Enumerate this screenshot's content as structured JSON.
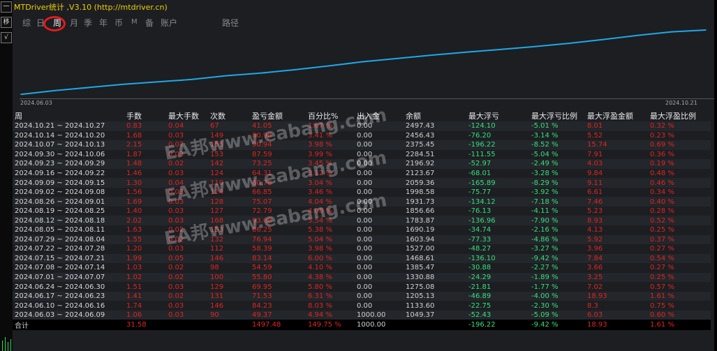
{
  "left_buttons": [
    "一",
    "移",
    "√"
  ],
  "title": "MTDriver统计 ,V3.10 (http://mtdriver.cn)",
  "tabs": [
    "综",
    "日",
    "周",
    "月",
    "季",
    "年",
    "币",
    "M",
    "备",
    "账户",
    "路径"
  ],
  "active_tab": "周",
  "chart_data": {
    "type": "line",
    "x": [
      "2024.06.09",
      "2024.06.16",
      "2024.06.23",
      "2024.06.30",
      "2024.07.07",
      "2024.07.14",
      "2024.07.21",
      "2024.07.28",
      "2024.08.04",
      "2024.08.11",
      "2024.08.18",
      "2024.08.25",
      "2024.09.01",
      "2024.09.08",
      "2024.09.15",
      "2024.09.22",
      "2024.09.29",
      "2024.10.06",
      "2024.10.13",
      "2024.10.20",
      "2024.10.27"
    ],
    "series": [
      {
        "values": [
          1049.37,
          1133.6,
          1205.13,
          1275.08,
          1330.88,
          1385.47,
          1468.61,
          1527.0,
          1603.94,
          1690.19,
          1783.87,
          1856.66,
          1931.73,
          1998.58,
          2059.36,
          2123.67,
          2196.92,
          2284.51,
          2375.45,
          2456.43,
          2497.43
        ]
      }
    ],
    "xlabel_start": "2024.06.03",
    "xlabel_end": "2024.10.21",
    "line_color": "#1fa8e8"
  },
  "table": {
    "headers": [
      "周",
      "手数",
      "最大手数",
      "次数",
      "盈亏金额",
      "百分比%",
      "出入金",
      "余额",
      "最大浮亏",
      "最大浮亏比例",
      "最大浮盈金额",
      "最大浮盈比例"
    ],
    "rows": [
      [
        "2024.10.21 ~ 2024.10.27",
        "0.83",
        "0.04",
        "67",
        "41.05",
        "1.67 %",
        "0.00",
        "2497.43",
        "-124.10",
        "-5.01 %",
        "8.01",
        "0.32 %"
      ],
      [
        "2024.10.14 ~ 2024.10.20",
        "1.68",
        "0.03",
        "149",
        "80.98",
        "3.41 %",
        "0.00",
        "2456.43",
        "-76.20",
        "-3.14 %",
        "5.52",
        "0.23 %"
      ],
      [
        "2024.10.07 ~ 2024.10.13",
        "2.15",
        "0.07",
        "155",
        "90.94",
        "3.98 %",
        "0.00",
        "2375.45",
        "-196.22",
        "-8.52 %",
        "15.74",
        "0.69 %"
      ],
      [
        "2024.09.30 ~ 2024.10.06",
        "1.87",
        "0.03",
        "153",
        "87.59",
        "3.99 %",
        "0.00",
        "2284.51",
        "-111.55",
        "-5.04 %",
        "7.91",
        "0.36 %"
      ],
      [
        "2024.09.23 ~ 2024.09.29",
        "1.48",
        "0.02",
        "142",
        "73.25",
        "3.45 %",
        "0.00",
        "2196.92",
        "-52.97",
        "-2.49 %",
        "4.03",
        "0.19 %"
      ],
      [
        "2024.09.16 ~ 2024.09.22",
        "1.46",
        "0.03",
        "124",
        "64.31",
        "3.12 %",
        "0.00",
        "2123.67",
        "-68.01",
        "-3.28 %",
        "9.84",
        "0.48 %"
      ],
      [
        "2024.09.09 ~ 2024.09.15",
        "1.30",
        "0.04",
        "110",
        "60.78",
        "3.04 %",
        "0.00",
        "2059.36",
        "-165.89",
        "-8.29 %",
        "9.11",
        "0.46 %"
      ],
      [
        "2024.09.02 ~ 2024.09.08",
        "1.56",
        "0.03",
        "124",
        "66.85",
        "3.46 %",
        "0.00",
        "1998.58",
        "-75.77",
        "-3.92 %",
        "6.61",
        "0.34 %"
      ],
      [
        "2024.08.26 ~ 2024.09.01",
        "1.69",
        "0.03",
        "128",
        "75.07",
        "4.04 %",
        "0.00",
        "1931.73",
        "-134.12",
        "-7.18 %",
        "7.46",
        "0.40 %"
      ],
      [
        "2024.08.19 ~ 2024.08.25",
        "1.40",
        "0.03",
        "127",
        "72.79",
        "4.08 %",
        "0.00",
        "1856.66",
        "-76.13",
        "-4.11 %",
        "5.23",
        "0.28 %"
      ],
      [
        "2024.08.12 ~ 2024.08.18",
        "2.02",
        "0.03",
        "168",
        "93.68",
        "5.54 %",
        "0.00",
        "1783.87",
        "-136.96",
        "-7.90 %",
        "8.93",
        "0.52 %"
      ],
      [
        "2024.08.05 ~ 2024.08.11",
        "1.63",
        "0.02",
        "153",
        "86.25",
        "5.38 %",
        "0.00",
        "1690.19",
        "-34.74",
        "-2.16 %",
        "4.13",
        "0.25 %"
      ],
      [
        "2024.07.29 ~ 2024.08.04",
        "1.55",
        "0.02",
        "132",
        "76.94",
        "5.04 %",
        "0.00",
        "1603.94",
        "-77.33",
        "-4.86 %",
        "5.92",
        "0.37 %"
      ],
      [
        "2024.07.22 ~ 2024.07.28",
        "1.20",
        "0.03",
        "112",
        "58.39",
        "3.98 %",
        "0.00",
        "1527.00",
        "-48.27",
        "-3.27 %",
        "3.96",
        "0.27 %"
      ],
      [
        "2024.07.15 ~ 2024.07.21",
        "1.99",
        "0.05",
        "146",
        "83.14",
        "6.00 %",
        "0.00",
        "1468.61",
        "-136.10",
        "-9.42 %",
        "7.84",
        "0.54 %"
      ],
      [
        "2024.07.08 ~ 2024.07.14",
        "1.03",
        "0.02",
        "98",
        "54.59",
        "4.10 %",
        "0.00",
        "1385.47",
        "-30.88",
        "-2.27 %",
        "3.66",
        "0.27 %"
      ],
      [
        "2024.07.01 ~ 2024.07.07",
        "1.02",
        "0.02",
        "100",
        "55.80",
        "4.38 %",
        "0.00",
        "1330.88",
        "-24.29",
        "-1.89 %",
        "3.25",
        "0.25 %"
      ],
      [
        "2024.06.24 ~ 2024.06.30",
        "1.51",
        "0.03",
        "129",
        "69.95",
        "5.80 %",
        "0.00",
        "1275.08",
        "-21.81",
        "-1.77 %",
        "7.02",
        "0.57 %"
      ],
      [
        "2024.06.17 ~ 2024.06.23",
        "1.41",
        "0.02",
        "131",
        "71.53",
        "6.31 %",
        "0.00",
        "1205.13",
        "-46.89",
        "-4.00 %",
        "18.93",
        "1.61 %"
      ],
      [
        "2024.06.10 ~ 2024.06.16",
        "1.74",
        "0.03",
        "146",
        "84.23",
        "8.03 %",
        "0.00",
        "1133.60",
        "-22.75",
        "-2.30 %",
        "8.3",
        "0.75 %"
      ],
      [
        "2024.06.03 ~ 2024.06.09",
        "1.06",
        "0.03",
        "90",
        "49.37",
        "4.94 %",
        "1000.00",
        "1049.37",
        "-52.43",
        "-5.09 %",
        "6.03",
        "0.60 %"
      ]
    ],
    "totals": [
      "合计",
      "31.58",
      "",
      "",
      "1497.48",
      "149.75 %",
      "1000.00",
      "",
      "-196.22",
      "-9.42 %",
      "18.93",
      "1.61 %"
    ]
  },
  "watermark": "EA邦www.eabang.com"
}
